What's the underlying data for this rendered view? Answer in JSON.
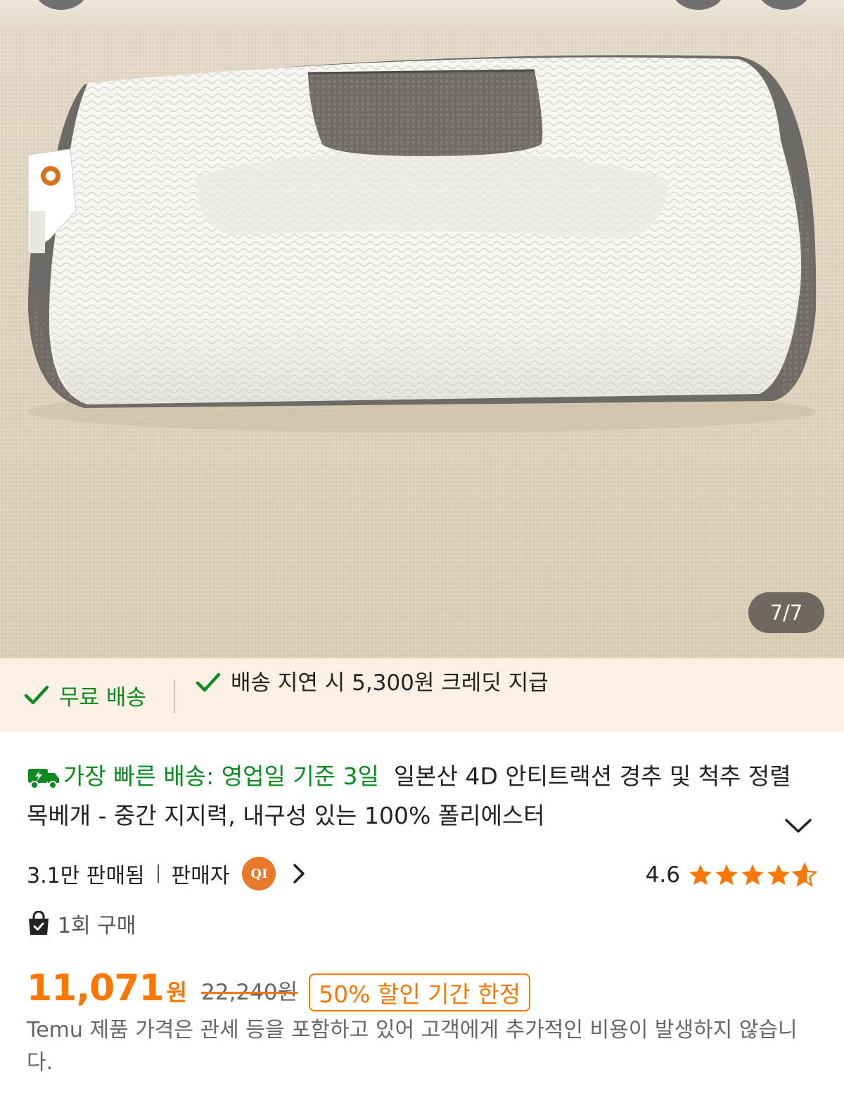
{
  "gallery": {
    "counter": "7/7",
    "image_alt": "product-pillow-photo"
  },
  "benefits": {
    "free_shipping": "무료 배송",
    "delay_credit": "배송 지연 시 5,300원 크레딧 지급"
  },
  "product": {
    "fast_delivery": "가장 빠른 배송: 영업일 기준 3일",
    "title": "일본산 4D 안티트랙션 경추 및 척추 정렬 목베개 - 중간 지지력, 내구성 있는 100% 폴리에스터",
    "sold": "3.1만 판매됨",
    "seller_label": "판매자",
    "seller_badge": "QI",
    "rating": "4.6",
    "rating_value": 4.6,
    "purchases": "1회 구매",
    "price": "11,071",
    "price_unit": "원",
    "original_price": "22,240원",
    "discount_label": "50% 할인 기간 한정",
    "notice": "Temu 제품 가격은 관세 등을 포함하고 있어 고객에게 추가적인 비용이 발생하지 않습니다."
  },
  "colors": {
    "accent": "#fb7701",
    "green": "#0a8a1f",
    "benefit_bg": "#fdf0e5"
  }
}
